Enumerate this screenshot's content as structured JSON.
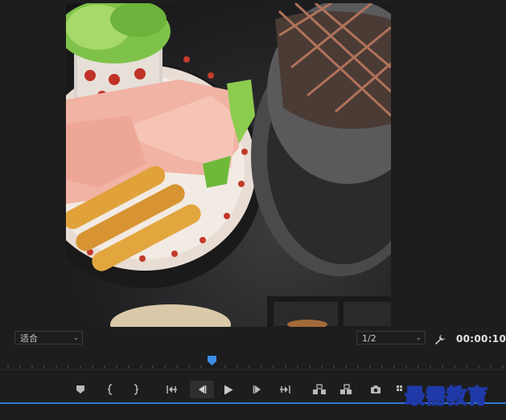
{
  "monitor": {
    "zoom_label": "适合",
    "resolution_label": "1/2",
    "timecode": "00:00:10:"
  },
  "icons": {
    "settings": "wrench-icon",
    "add_marker": "marker-icon",
    "mark_in": "mark-in-icon",
    "mark_out": "mark-out-icon",
    "go_to_in": "go-to-in-icon",
    "step_back": "step-back-icon",
    "play": "play-icon",
    "step_forward": "step-forward-icon",
    "go_to_out": "go-to-out-icon",
    "lift": "lift-icon",
    "extract": "extract-icon",
    "export_frame": "camera-icon",
    "more": "more-icon"
  },
  "watermark": {
    "text": "最需教育"
  },
  "colors": {
    "playhead": "#3a8ee6",
    "accent_line": "#3678d6",
    "background": "#1d1d1d"
  }
}
